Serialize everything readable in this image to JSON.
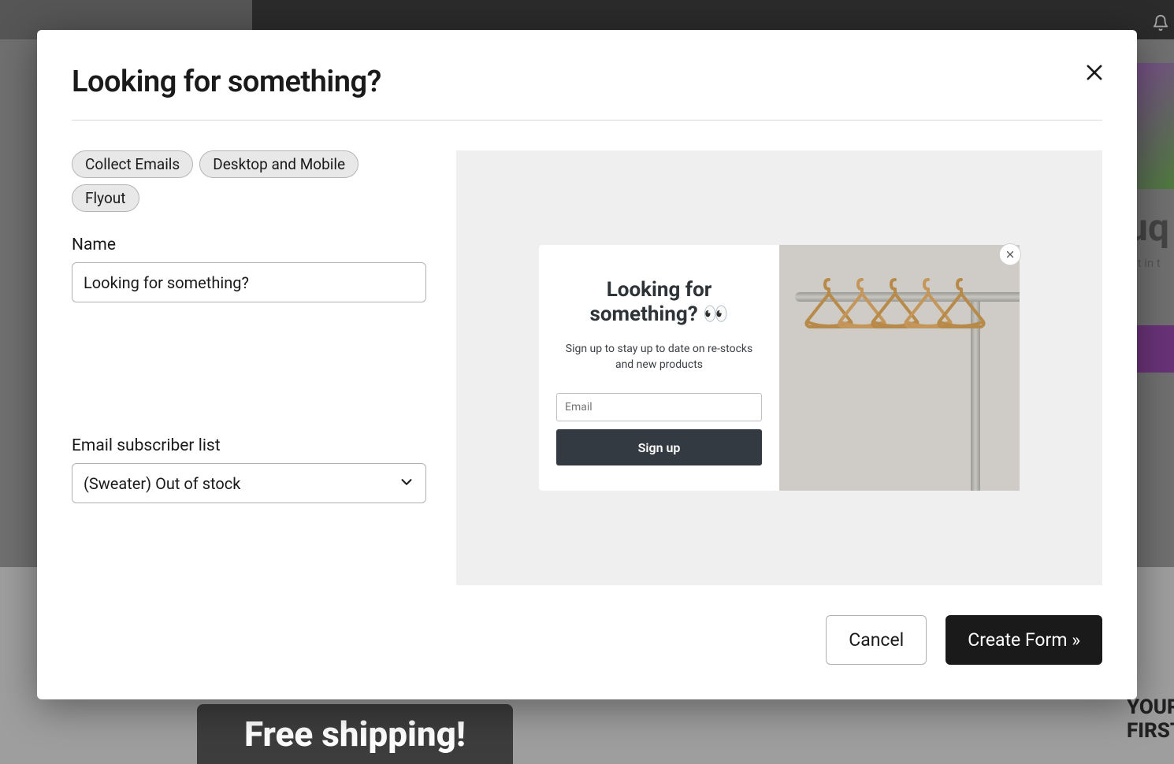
{
  "modal": {
    "title": "Looking for something?",
    "tags": [
      "Collect Emails",
      "Desktop and Mobile",
      "Flyout"
    ],
    "name_label": "Name",
    "name_value": "Looking for something?",
    "list_label": "Email subscriber list",
    "list_selected": "(Sweater) Out of stock",
    "cancel_label": "Cancel",
    "create_label": "Create Form »"
  },
  "preview": {
    "title": "Looking for something? 👀",
    "subtitle": "Sign up to stay up to date on re-stocks and new products",
    "email_placeholder": "Email",
    "button_label": "Sign up"
  },
  "background": {
    "banner": "Free shipping!",
    "right_title": "uq",
    "right_sub": "art in t",
    "right_your": "YOUR FIRST"
  }
}
